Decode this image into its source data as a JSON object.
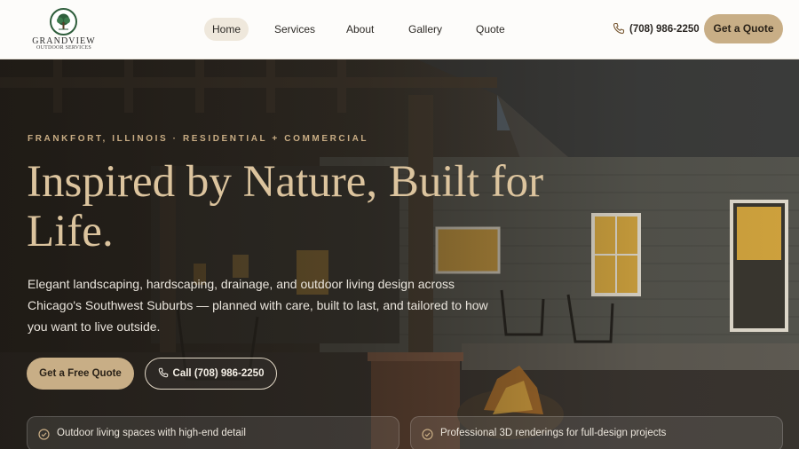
{
  "brand": {
    "name": "GRANDVIEW",
    "tagline": "OUTDOOR SERVICES",
    "colors": {
      "accent": "#c8ae86",
      "green": "#2f5e3c",
      "headline": "#dcc49e"
    }
  },
  "nav": {
    "items": [
      {
        "label": "Home",
        "active": true
      },
      {
        "label": "Services",
        "active": false
      },
      {
        "label": "About",
        "active": false
      },
      {
        "label": "Gallery",
        "active": false
      },
      {
        "label": "Quote",
        "active": false
      }
    ]
  },
  "header": {
    "phone": "(708) 986-2250",
    "phone_icon": "phone-icon",
    "cta_label": "Get a Quote"
  },
  "hero": {
    "eyebrow": "FRANKFORT, ILLINOIS · RESIDENTIAL + COMMERCIAL",
    "headline": "Inspired by Nature, Built for Life.",
    "lede": "Elegant landscaping, hardscaping, drainage, and outdoor living design across Chicago's Southwest Suburbs — planned with care, built to last, and tailored to how you want to live outside.",
    "primary_cta": "Get a Free Quote",
    "secondary_cta": "Call (708) 986-2250"
  },
  "features": [
    {
      "label": "Outdoor living spaces with high-end detail",
      "icon": "check-circle-icon"
    },
    {
      "label": "Professional 3D renderings for full-design projects",
      "icon": "check-circle-icon"
    }
  ]
}
